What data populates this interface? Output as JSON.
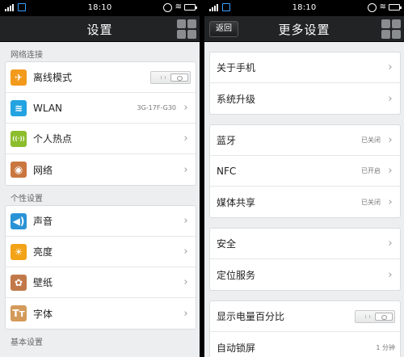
{
  "status_bar": {
    "time": "18:10"
  },
  "left": {
    "title": "设置",
    "sections": [
      {
        "label": "网络连接",
        "items": [
          {
            "label": "离线模式",
            "value": "",
            "icon": "airplane-icon",
            "glyph": "✈",
            "color": "#f29a1c",
            "control": "toggle",
            "toggle_on": false
          },
          {
            "label": "WLAN",
            "value": "3G-17F-G30",
            "icon": "wifi-icon",
            "glyph": "≋",
            "color": "#23a3e0",
            "control": "chevron"
          },
          {
            "label": "个人热点",
            "value": "",
            "icon": "hotspot-icon",
            "glyph": "((·))",
            "color": "#8cbd2d",
            "control": "chevron"
          },
          {
            "label": "网络",
            "value": "",
            "icon": "globe-icon",
            "glyph": "◉",
            "color": "#c9773f",
            "control": "chevron"
          }
        ]
      },
      {
        "label": "个性设置",
        "items": [
          {
            "label": "声音",
            "value": "",
            "icon": "speaker-icon",
            "glyph": "◀)",
            "color": "#2a93d6",
            "control": "chevron"
          },
          {
            "label": "亮度",
            "value": "",
            "icon": "brightness-icon",
            "glyph": "☀",
            "color": "#f2a318",
            "control": "chevron"
          },
          {
            "label": "壁纸",
            "value": "",
            "icon": "wallpaper-icon",
            "glyph": "✿",
            "color": "#c2794a",
            "control": "chevron"
          },
          {
            "label": "字体",
            "value": "",
            "icon": "font-icon",
            "glyph": "Tт",
            "color": "#d39a5a",
            "control": "chevron"
          }
        ]
      },
      {
        "label": "基本设置",
        "items": []
      }
    ]
  },
  "right": {
    "back_label": "返回",
    "title": "更多设置",
    "groups": [
      [
        {
          "label": "关于手机",
          "value": "",
          "control": "chevron"
        },
        {
          "label": "系统升级",
          "value": "",
          "control": "chevron"
        }
      ],
      [
        {
          "label": "蓝牙",
          "value": "已关闭",
          "control": "chevron"
        },
        {
          "label": "NFC",
          "value": "已开启",
          "control": "chevron"
        },
        {
          "label": "媒体共享",
          "value": "已关闭",
          "control": "chevron"
        }
      ],
      [
        {
          "label": "安全",
          "value": "",
          "control": "chevron"
        },
        {
          "label": "定位服务",
          "value": "",
          "control": "chevron"
        }
      ],
      [
        {
          "label": "显示电量百分比",
          "value": "",
          "control": "toggle",
          "toggle_on": false
        },
        {
          "label": "自动锁屏",
          "value": "1 分钟",
          "control": "none"
        }
      ]
    ]
  }
}
